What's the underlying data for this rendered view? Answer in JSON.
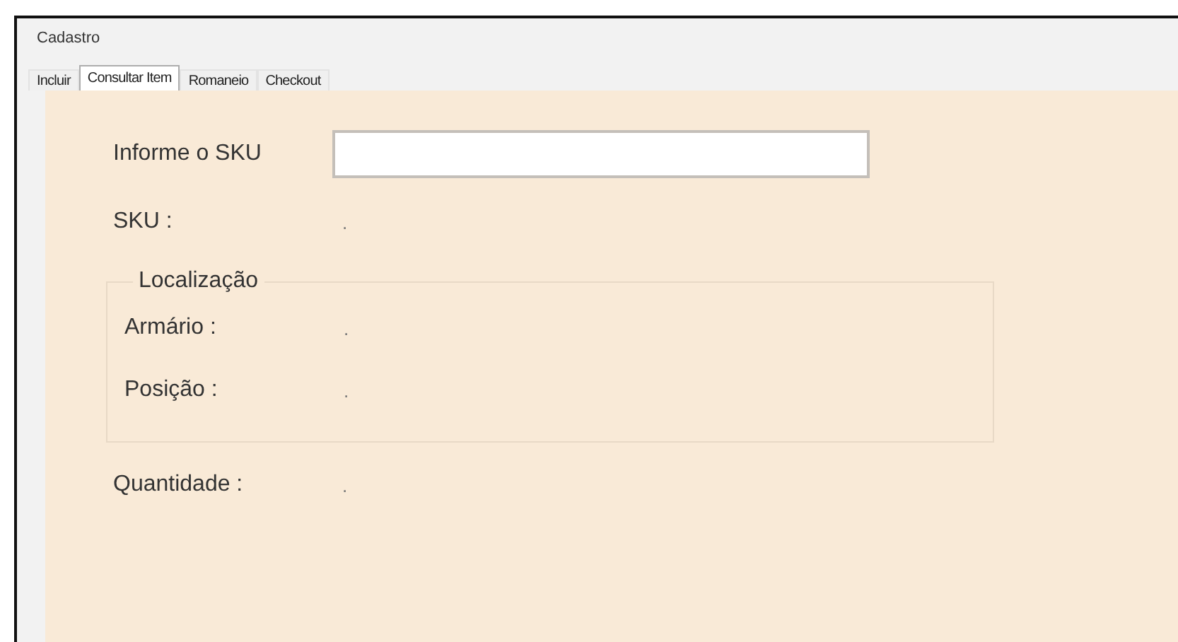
{
  "window": {
    "title": "Cadastro"
  },
  "tabs": [
    {
      "label": "Incluir",
      "selected": false
    },
    {
      "label": "Consultar Item",
      "selected": true
    },
    {
      "label": "Romaneio",
      "selected": false
    },
    {
      "label": "Checkout",
      "selected": false
    }
  ],
  "sku_field": {
    "label": "Informe o SKU"
  },
  "sku": {
    "label": "SKU :",
    "value": "."
  },
  "location": {
    "title": "Localização",
    "fields": [
      {
        "label": "Armário :",
        "value": "."
      },
      {
        "label": "Posição :",
        "value": "."
      }
    ]
  },
  "quantity": {
    "label": "Quantidade :",
    "value": "."
  }
}
